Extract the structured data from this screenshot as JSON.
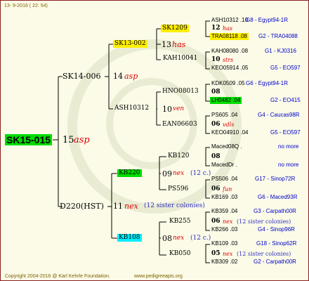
{
  "header": {
    "date": "13-  9-2016 ( 22: 54)"
  },
  "footer": {
    "copyright": "Copyright 2004-2016 @ Karl Kehrle Foundation.",
    "website": "www.pedigreeapis.org"
  },
  "colors": {
    "border": "#8a2020",
    "root_bg": "#00dd00",
    "highlight_yellow": "#ffee00",
    "highlight_green": "#00dd00",
    "highlight_cyan": "#00eeff",
    "note_red": "#e00000",
    "link_blue": "#0000c8"
  },
  "root": {
    "id": "SK15-015",
    "year": "15",
    "breeder": "asp"
  },
  "g1": {
    "father": {
      "id": "SK14-006",
      "year": "14",
      "breeder": "asp"
    },
    "mother": {
      "id": "D220(HST)",
      "year": "11",
      "breeder": "nex",
      "note": "(12 sister colonies)"
    }
  },
  "g2": {
    "ff": {
      "id": "SK13-002",
      "year": "13",
      "breeder": "has"
    },
    "fm": {
      "id": "ASH10312",
      "year": "10",
      "breeder": "ven"
    },
    "mf": {
      "id": "KB220",
      "year": "09",
      "breeder": "nex",
      "note": "(12 c.)"
    },
    "mm": {
      "id": "KB108",
      "year": "08",
      "breeder": "nex",
      "note": "(12 c.)"
    }
  },
  "g3": {
    "fff": {
      "id": "SK1209",
      "year": "12",
      "breeder": "has"
    },
    "ffm": {
      "id": "KAH10041",
      "year": "10",
      "breeder": "strs"
    },
    "fmf": {
      "id": "HNO08013",
      "year": "08",
      "breeder": ""
    },
    "fmm": {
      "id": "EAN06603",
      "year": "06",
      "breeder": "vdls"
    },
    "mff": {
      "id": "KB120",
      "year": "08",
      "breeder": ""
    },
    "mfm": {
      "id": "PS596",
      "year": "06",
      "breeder": "fun"
    },
    "mmf": {
      "id": "KB255",
      "year": "06",
      "breeder": "nex",
      "note": "(12 sister colonies)"
    },
    "mmm": {
      "id": "KB050",
      "year": "05",
      "breeder": "nex",
      "note": "(12 sister colonies)"
    }
  },
  "g4": [
    {
      "id": "ASH10312 .10",
      "line": "G8 - Egypt94-1R"
    },
    {
      "id": "TRA08118 .08",
      "line": "G2 - TRA04088"
    },
    {
      "id": "KAH08080 .08",
      "line": "G1 - KJ0316"
    },
    {
      "id": "KEO05914 .05",
      "line": "G5 - EO597"
    },
    {
      "id": "KDK0509 .05",
      "line": "G6 - Egypt94-1R"
    },
    {
      "id": "LH0482 .04",
      "line": "G2 - EO415"
    },
    {
      "id": "PS605 .04",
      "line": "G4 - Caucas98R"
    },
    {
      "id": "KEO04910 .04",
      "line": "G5 - EO597"
    },
    {
      "id": "Maced08Q .",
      "line": "no more"
    },
    {
      "id": "MacedDr .",
      "line": "no more"
    },
    {
      "id": "PS506 .04",
      "line": "G17 - Sinop72R"
    },
    {
      "id": "KB169 .03",
      "line": "G6 - Maced93R"
    },
    {
      "id": "KB359 .04",
      "line": "G3 - Carpath00R"
    },
    {
      "id": "KB266 .03",
      "line": "G4 - Sinop96R"
    },
    {
      "id": "KB109 .03",
      "line": "G18 - Sinop62R"
    },
    {
      "id": "KB309 .02",
      "line": "G2 - Carpath00R"
    }
  ]
}
